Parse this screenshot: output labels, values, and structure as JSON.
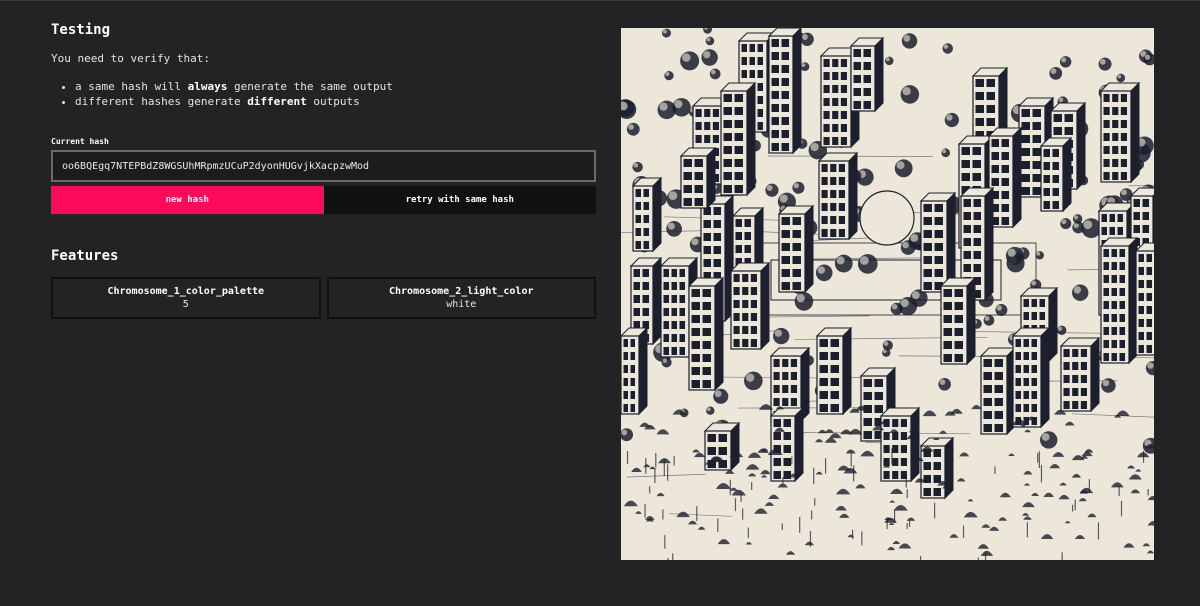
{
  "section_testing": {
    "title": "Testing",
    "intro": "You need to verify that:",
    "requirements": [
      {
        "pre": "a same hash will ",
        "bold": "always",
        "post": " generate the same output"
      },
      {
        "pre": "different hashes generate ",
        "bold": "different",
        "post": " outputs"
      }
    ]
  },
  "hash": {
    "label": "Current hash",
    "value": "oo6BQEgq7NTEPBdZ8WGSUhMRpmzUCuP2dyonHUGvjkXacpzwMod"
  },
  "buttons": {
    "new_hash": "new hash",
    "retry": "retry with same hash"
  },
  "features": {
    "title": "Features",
    "items": [
      {
        "name": "Chromosome_1_color_palette",
        "value": "5"
      },
      {
        "name": "Chromosome_2_light_color",
        "value": "white"
      }
    ]
  },
  "colors": {
    "accent": "#ff0a5b",
    "background": "#232325",
    "art_background": "#ece7d9",
    "art_ink": "#1b1f2e"
  },
  "artwork": {
    "icon": "generative-city-artwork"
  }
}
